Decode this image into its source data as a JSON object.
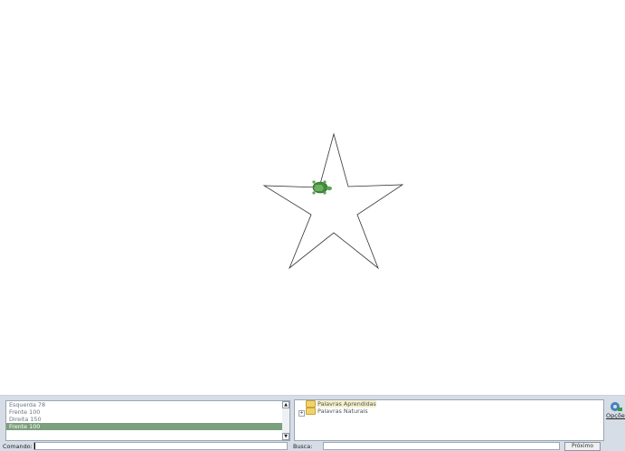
{
  "history": {
    "items": [
      "Esquerda 78",
      "Frente 100",
      "Direita 150",
      "Frente 100"
    ],
    "selected_index": 3
  },
  "tree": {
    "items": [
      "Palavras Aprendidas",
      "Palavras Naturais"
    ]
  },
  "options": {
    "label": "Opções"
  },
  "command": {
    "label": "Comando:",
    "value": ""
  },
  "search": {
    "label": "Busca:",
    "value": "",
    "next_label": "Próximo"
  }
}
